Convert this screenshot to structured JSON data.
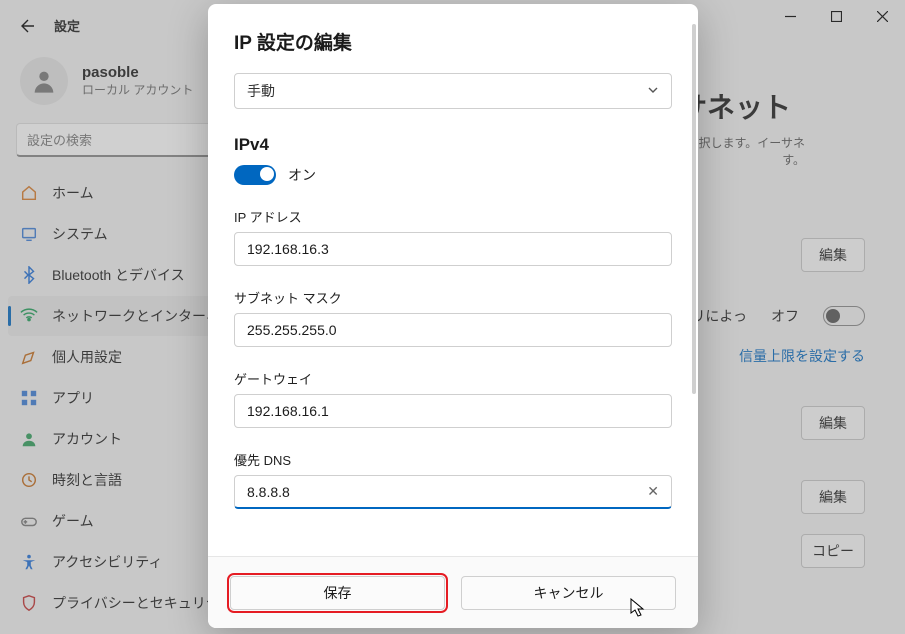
{
  "window": {
    "settings_title": "設定"
  },
  "user": {
    "name": "pasoble",
    "account": "ローカル アカウント"
  },
  "search": {
    "placeholder": "設定の検索"
  },
  "nav": [
    {
      "icon": "home",
      "label": "ホーム"
    },
    {
      "icon": "system",
      "label": "システム"
    },
    {
      "icon": "bluetooth",
      "label": "Bluetooth とデバイス"
    },
    {
      "icon": "network",
      "label": "ネットワークとインターネット",
      "active": true
    },
    {
      "icon": "personalize",
      "label": "個人用設定"
    },
    {
      "icon": "apps",
      "label": "アプリ"
    },
    {
      "icon": "accounts",
      "label": "アカウント"
    },
    {
      "icon": "time",
      "label": "時刻と言語"
    },
    {
      "icon": "gaming",
      "label": "ゲーム"
    },
    {
      "icon": "accessibility",
      "label": "アクセシビリティ"
    },
    {
      "icon": "privacy",
      "label": "プライバシーとセキュリティ"
    }
  ],
  "page": {
    "heading_suffix": "サネット",
    "subtitle_line1": "れを選択します。イーサネ",
    "subtitle_line2": "す。",
    "metered_app": "プリによっ",
    "metered_state": "オフ",
    "data_limit_link": "信量上限を設定する",
    "btn_edit": "編集",
    "btn_copy": "コピー"
  },
  "dialog": {
    "title": "IP 設定の編集",
    "mode": "手動",
    "ipv4": {
      "heading": "IPv4",
      "state": "オン"
    },
    "fields": {
      "ip_label": "IP アドレス",
      "ip_value": "192.168.16.3",
      "subnet_label": "サブネット マスク",
      "subnet_value": "255.255.255.0",
      "gateway_label": "ゲートウェイ",
      "gateway_value": "192.168.16.1",
      "dns_label": "優先 DNS",
      "dns_value": "8.8.8.8"
    },
    "save": "保存",
    "cancel": "キャンセル"
  }
}
